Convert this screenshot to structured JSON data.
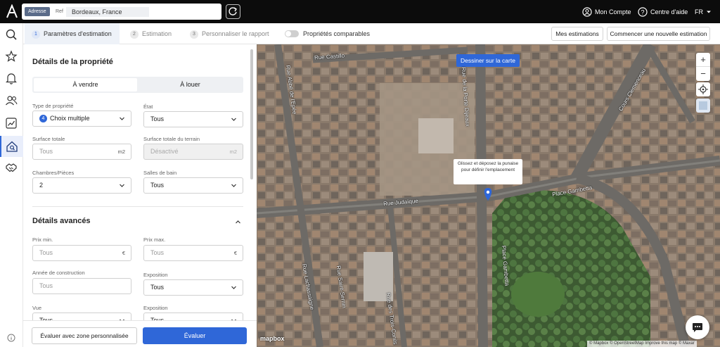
{
  "header": {
    "search": {
      "mode_address": "Adresse",
      "mode_ref": "Ref",
      "value": "Bordeaux, France"
    },
    "account": "Mon Compte",
    "help": "Centre d'aide",
    "language": "FR"
  },
  "tabs": [
    {
      "num": "1",
      "label": "Paramètres d'estimation"
    },
    {
      "num": "2",
      "label": "Estimation"
    },
    {
      "num": "3",
      "label": "Personnaliser le rapport"
    }
  ],
  "toolbar": {
    "comparables_label": "Propriétés comparables",
    "my_estimations": "Mes estimations",
    "new_estimation": "Commencer une nouvelle estimation"
  },
  "form": {
    "property_details_title": "Détails de la propriété",
    "sale_option": "À vendre",
    "rent_option": "À louer",
    "property_type": {
      "label": "Type de propriété",
      "badge": "4",
      "value": "Choix multiple"
    },
    "state": {
      "label": "État",
      "value": "Tous"
    },
    "total_surface": {
      "label": "Surface totale",
      "placeholder": "Tous",
      "unit": "m2"
    },
    "land_surface": {
      "label": "Surface totale du terrain",
      "placeholder": "Désactivé",
      "unit": "m2"
    },
    "rooms": {
      "label": "Chambres/Pièces",
      "value": "2"
    },
    "bathrooms": {
      "label": "Salles de bain",
      "value": "Tous"
    },
    "advanced_title": "Détails avancés",
    "price_min": {
      "label": "Prix min.",
      "placeholder": "Tous",
      "unit": "€"
    },
    "price_max": {
      "label": "Prix max.",
      "placeholder": "Tous",
      "unit": "€"
    },
    "build_year": {
      "label": "Année de construction",
      "placeholder": "Tous"
    },
    "exposure": {
      "label": "Exposition",
      "value": "Tous"
    },
    "view": {
      "label": "Vue",
      "value": "Tous"
    },
    "exposure2": {
      "label": "Exposition",
      "value": "Tous"
    }
  },
  "footer": {
    "custom_zone": "Évaluer avec zone personnalisée",
    "evaluate": "Évaluer"
  },
  "map": {
    "draw_button": "Dessiner sur la carte",
    "tooltip": "Glissez et déposez la punaise pour définir l'emplacement",
    "streets": {
      "castillon": "Rue Castillo",
      "abbe": "Rue Abbé de l'Epée",
      "judaique": "Rue Judaïque",
      "gambetta_place": "Place Gambetta",
      "gambetta_place2": "Place Gambetta",
      "clemenceau": "Cours Clemenceau",
      "porte": "Rue de la Porte Dijeaux",
      "lachassaigne": "Rue Lachassaigne",
      "saint_sernin": "Rue Saint-Sernin",
      "treilles": "Rue des Trois-Conils"
    },
    "logo": "mapbox",
    "attribution": "© Mapbox © OpenStreetMap Improve this map © Maxar"
  },
  "colors": {
    "accent": "#2f67d8",
    "topbar": "#0c0c0c"
  }
}
